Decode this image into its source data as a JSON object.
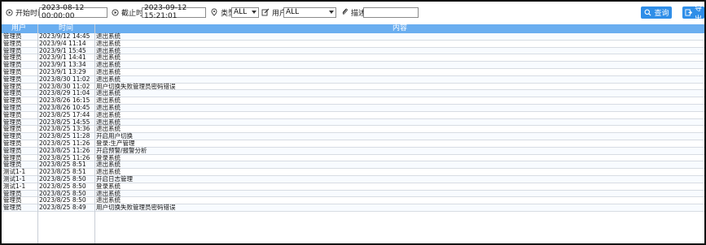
{
  "toolbar": {
    "start_label": "开始时间",
    "start_value": "2023-08-12 00:00:00",
    "end_label": "截止时间",
    "end_value": "2023-09-12 15:21:01",
    "type_label": "类型",
    "type_value": "ALL",
    "user_label": "用户",
    "user_value": "ALL",
    "desc_label": "描述",
    "desc_value": "",
    "search_label": "查询",
    "export_label": "导出"
  },
  "table": {
    "headers": [
      "用户",
      "时间",
      "内容"
    ],
    "rows": [
      [
        "管理员",
        "2023/9/12 14:45",
        "退出系统"
      ],
      [
        "管理员",
        "2023/9/4 11:14",
        "退出系统"
      ],
      [
        "管理员",
        "2023/9/1 15:45",
        "退出系统"
      ],
      [
        "管理员",
        "2023/9/1 14:41",
        "退出系统"
      ],
      [
        "管理员",
        "2023/9/1 13:34",
        "退出系统"
      ],
      [
        "管理员",
        "2023/9/1 13:29",
        "退出系统"
      ],
      [
        "管理员",
        "2023/8/30 11:02",
        "退出系统"
      ],
      [
        "管理员",
        "2023/8/30 11:02",
        "用户切换失败管理员密码错误"
      ],
      [
        "管理员",
        "2023/8/29 11:04",
        "退出系统"
      ],
      [
        "管理员",
        "2023/8/26 16:15",
        "退出系统"
      ],
      [
        "管理员",
        "2023/8/26 10:45",
        "退出系统"
      ],
      [
        "管理员",
        "2023/8/25 17:44",
        "退出系统"
      ],
      [
        "管理员",
        "2023/8/25 14:55",
        "退出系统"
      ],
      [
        "管理员",
        "2023/8/25 13:36",
        "退出系统"
      ],
      [
        "管理员",
        "2023/8/25 11:28",
        "开启用户切换"
      ],
      [
        "管理员",
        "2023/8/25 11:26",
        "登录:生产管理"
      ],
      [
        "管理员",
        "2023/8/25 11:26",
        "开启预警/报警分析"
      ],
      [
        "管理员",
        "2023/8/25 11:26",
        "登录系统"
      ],
      [
        "管理员",
        "2023/8/25 8:51",
        "退出系统"
      ],
      [
        "测试1-1",
        "2023/8/25 8:51",
        "退出系统"
      ],
      [
        "测试1-1",
        "2023/8/25 8:50",
        "开启日志管理"
      ],
      [
        "测试1-1",
        "2023/8/25 8:50",
        "登录系统"
      ],
      [
        "管理员",
        "2023/8/25 8:50",
        "退出系统"
      ],
      [
        "管理员",
        "2023/8/25 8:50",
        "退出系统"
      ],
      [
        "管理员",
        "2023/8/25 8:49",
        "用户切换失败管理员密码错误"
      ]
    ]
  },
  "colors": {
    "header_bg": "#6aaef0",
    "button_blue": "#2f8ee8"
  }
}
